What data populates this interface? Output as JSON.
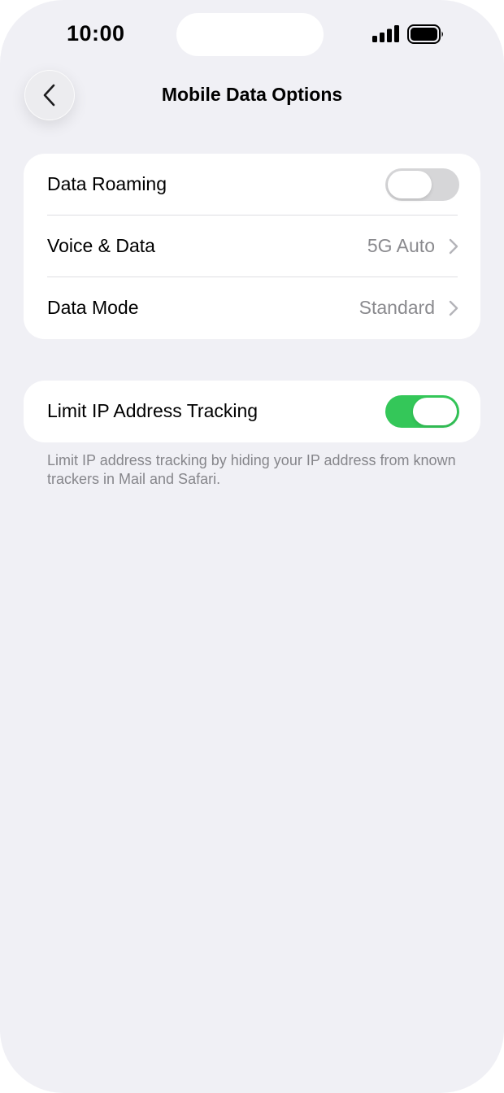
{
  "status_bar": {
    "time": "10:00",
    "signal_icon": "cellular-signal-icon",
    "battery_icon": "battery-full-icon"
  },
  "nav": {
    "back_icon": "chevron-left-icon",
    "title": "Mobile Data Options"
  },
  "group1": {
    "rows": [
      {
        "label": "Data Roaming",
        "control": "toggle",
        "on": false
      },
      {
        "label": "Voice & Data",
        "value": "5G Auto",
        "control": "chevron"
      },
      {
        "label": "Data Mode",
        "value": "Standard",
        "control": "chevron"
      }
    ]
  },
  "group2": {
    "rows": [
      {
        "label": "Limit IP Address Tracking",
        "control": "toggle",
        "on": true
      }
    ],
    "footer": "Limit IP address tracking by hiding your IP address from known trackers in Mail and Safari."
  },
  "colors": {
    "background": "#f0f0f5",
    "toggle_on": "#34c759",
    "toggle_off": "#d6d6d8",
    "secondary_text": "#8a8a8e"
  }
}
